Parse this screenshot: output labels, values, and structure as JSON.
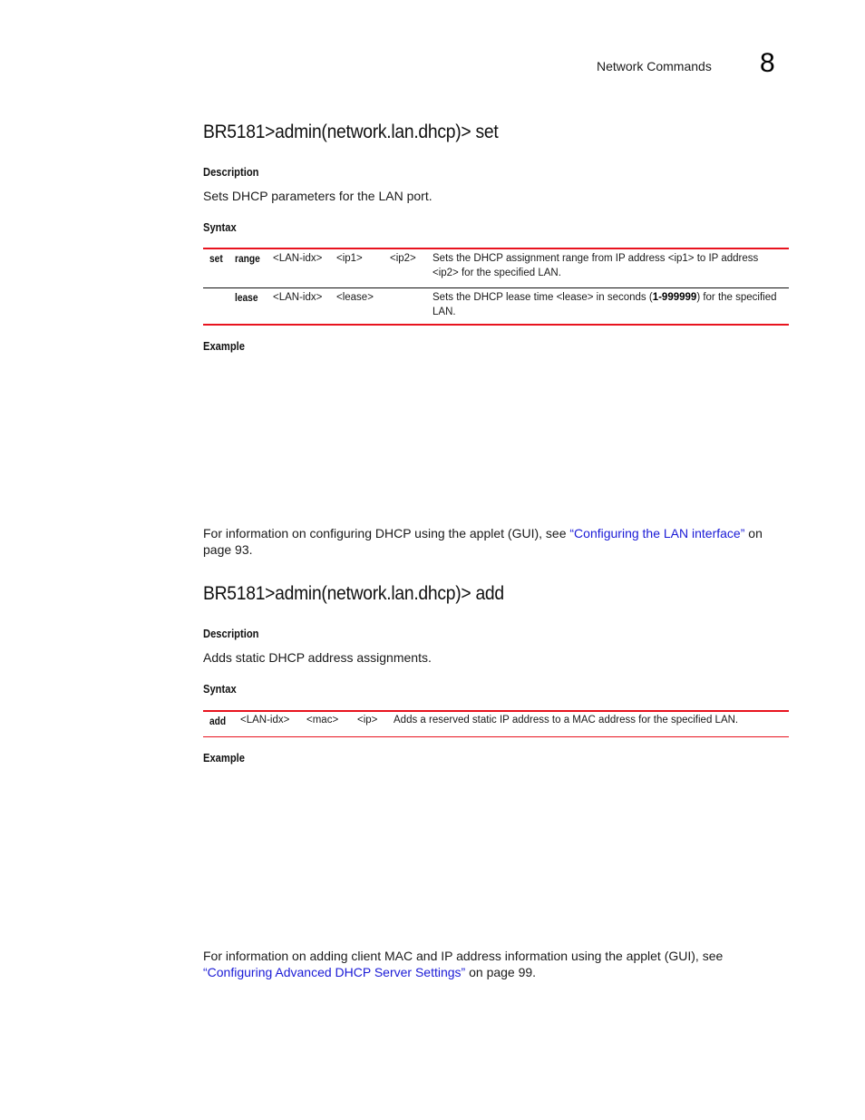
{
  "page_header": {
    "section": "Network Commands",
    "chapter_number": "8"
  },
  "sections": [
    {
      "title": "BR5181>admin(network.lan.dhcp)> set",
      "description_label": "Description",
      "description": "Sets DHCP parameters for the LAN port.",
      "syntax_label": "Syntax",
      "syntax_rows": [
        {
          "command": "set",
          "subcommand": "range",
          "args": [
            "<LAN-idx>",
            "<ip1>",
            "<ip2>"
          ],
          "description": "Sets the DHCP assignment range from IP address <ip1> to IP address <ip2> for the specified LAN."
        },
        {
          "command": "",
          "subcommand": "lease",
          "args": [
            "<LAN-idx>",
            "<lease>",
            ""
          ],
          "description_pre": "Sets the DHCP lease time <lease> in seconds (",
          "description_bold": "1-999999",
          "description_post": ") for the specified LAN."
        }
      ],
      "example_label": "Example",
      "footer_pre": "For information on configuring DHCP using the applet (GUI), see ",
      "footer_link": "“Configuring the LAN interface”",
      "footer_post": " on page 93."
    },
    {
      "title": "BR5181>admin(network.lan.dhcp)> add",
      "description_label": "Description",
      "description": "Adds static DHCP address assignments.",
      "syntax_label": "Syntax",
      "syntax_rows": [
        {
          "command": "add",
          "args": [
            "<LAN-idx>",
            "<mac>",
            "<ip>"
          ],
          "description": "Adds a reserved static IP address to a MAC address for the specified LAN."
        }
      ],
      "example_label": "Example",
      "footer_pre": "For information on adding client MAC and IP address information using the applet (GUI), see ",
      "footer_link": "“Configuring Advanced DHCP Server Settings”",
      "footer_post": " on page 99."
    }
  ],
  "colors": {
    "table_rule": "#e8131e",
    "link": "#1a1ad6"
  }
}
